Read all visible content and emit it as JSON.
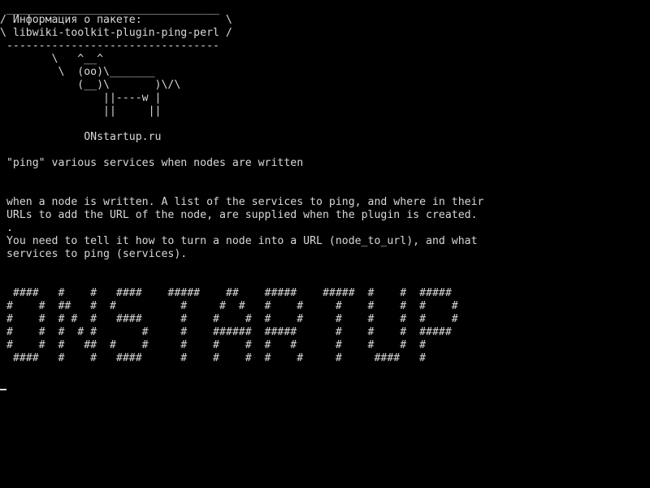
{
  "terminal": {
    "colors": {
      "background": "#000000",
      "foreground": "#d8d8d8"
    },
    "cowsay": {
      "bubble_top": " _________________________________",
      "bubble_line1": "/ Информация о пакете:             \\",
      "bubble_line2": "\\ libwiki-toolkit-plugin-ping-perl /",
      "bubble_bottom": " ---------------------------------",
      "cow_line1": "        \\   ^__^",
      "cow_line2": "         \\  (oo)\\_______",
      "cow_line3": "            (__)\\       )\\/\\",
      "cow_line4": "                ||----w |",
      "cow_line5": "                ||     ||",
      "site": "             ONstartup.ru"
    },
    "summary": " \"ping\" various services when nodes are written",
    "description": [
      " when a node is written. A list of the services to ping, and where in their",
      " URLs to add the URL of the node, are supplied when the plugin is created.",
      " .",
      " You need to tell it how to turn a node into a URL (node_to_url), and what",
      " services to ping (services)."
    ],
    "banner": [
      "  ####   #    #   ####    #####    ##    #####    #####  #    #  #####",
      " #    #  ##   #  #          #     #  #   #    #     #    #    #  #    #",
      " #    #  # #  #   ####      #    #    #  #    #     #    #    #  #    #",
      " #    #  #  # #       #     #    ######  #####      #    #    #  #####",
      " #    #  #   ##  #    #     #    #    #  #   #      #    #    #  #",
      "  ####   #    #   ####      #    #    #  #    #     #     ####   #"
    ]
  }
}
